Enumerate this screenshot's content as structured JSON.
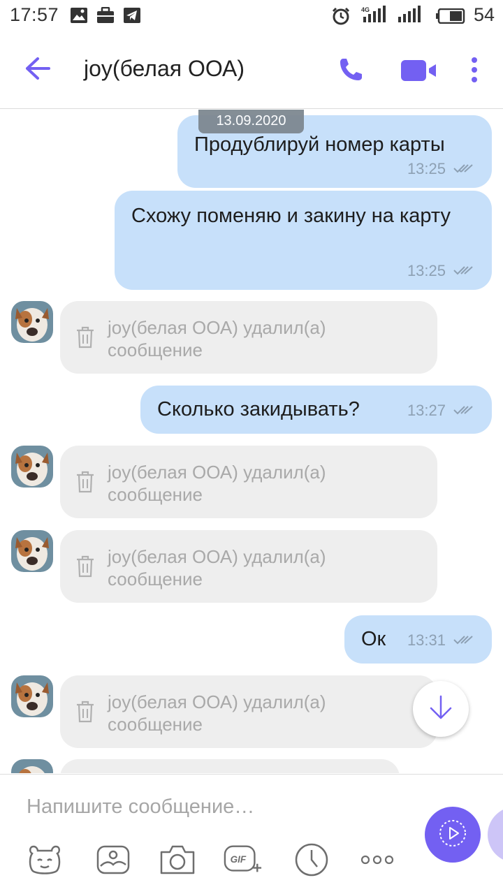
{
  "status_bar": {
    "time": "17:57",
    "network": "4G",
    "battery": "54",
    "icons": [
      "image-icon",
      "briefcase-icon",
      "telegram-icon",
      "alarm-icon",
      "signal-icon",
      "battery-icon"
    ]
  },
  "header": {
    "title": "joy(белая ООА)",
    "icons": [
      "back-arrow-icon",
      "phone-icon",
      "video-camera-icon",
      "more-vert-icon"
    ],
    "accent": "#7360f2"
  },
  "chat": {
    "date": "13.09.2020",
    "messages": [
      {
        "dir": "out",
        "text": "Продублируй номер карты",
        "time": "13:25"
      },
      {
        "dir": "out",
        "text": "Схожу поменяю и закину на карту",
        "time": "13:25"
      },
      {
        "dir": "in-deleted",
        "text": "joy(белая ООА) удалил(а) сообщение"
      },
      {
        "dir": "out",
        "text": "Сколько закидывать?",
        "time": "13:27"
      },
      {
        "dir": "in-deleted",
        "text": "joy(белая ООА) удалил(а) сообщение"
      },
      {
        "dir": "in-deleted",
        "text": "joy(белая ООА) удалил(а) сообщение"
      },
      {
        "dir": "out",
        "text": "Ок",
        "time": "13:31"
      },
      {
        "dir": "in-deleted",
        "text": "joy(белая ООА) удалил(а) сообщение"
      }
    ],
    "colors": {
      "outgoing_bubble": "#c7e0fa",
      "deleted_bubble": "#eeeeee"
    }
  },
  "composer": {
    "placeholder": "Напишите сообщение…",
    "tools": [
      "sticker-icon",
      "gallery-icon",
      "camera-icon",
      "gif-icon",
      "timer-icon",
      "more-horiz-icon"
    ],
    "send_icon": "send-video-icon"
  }
}
